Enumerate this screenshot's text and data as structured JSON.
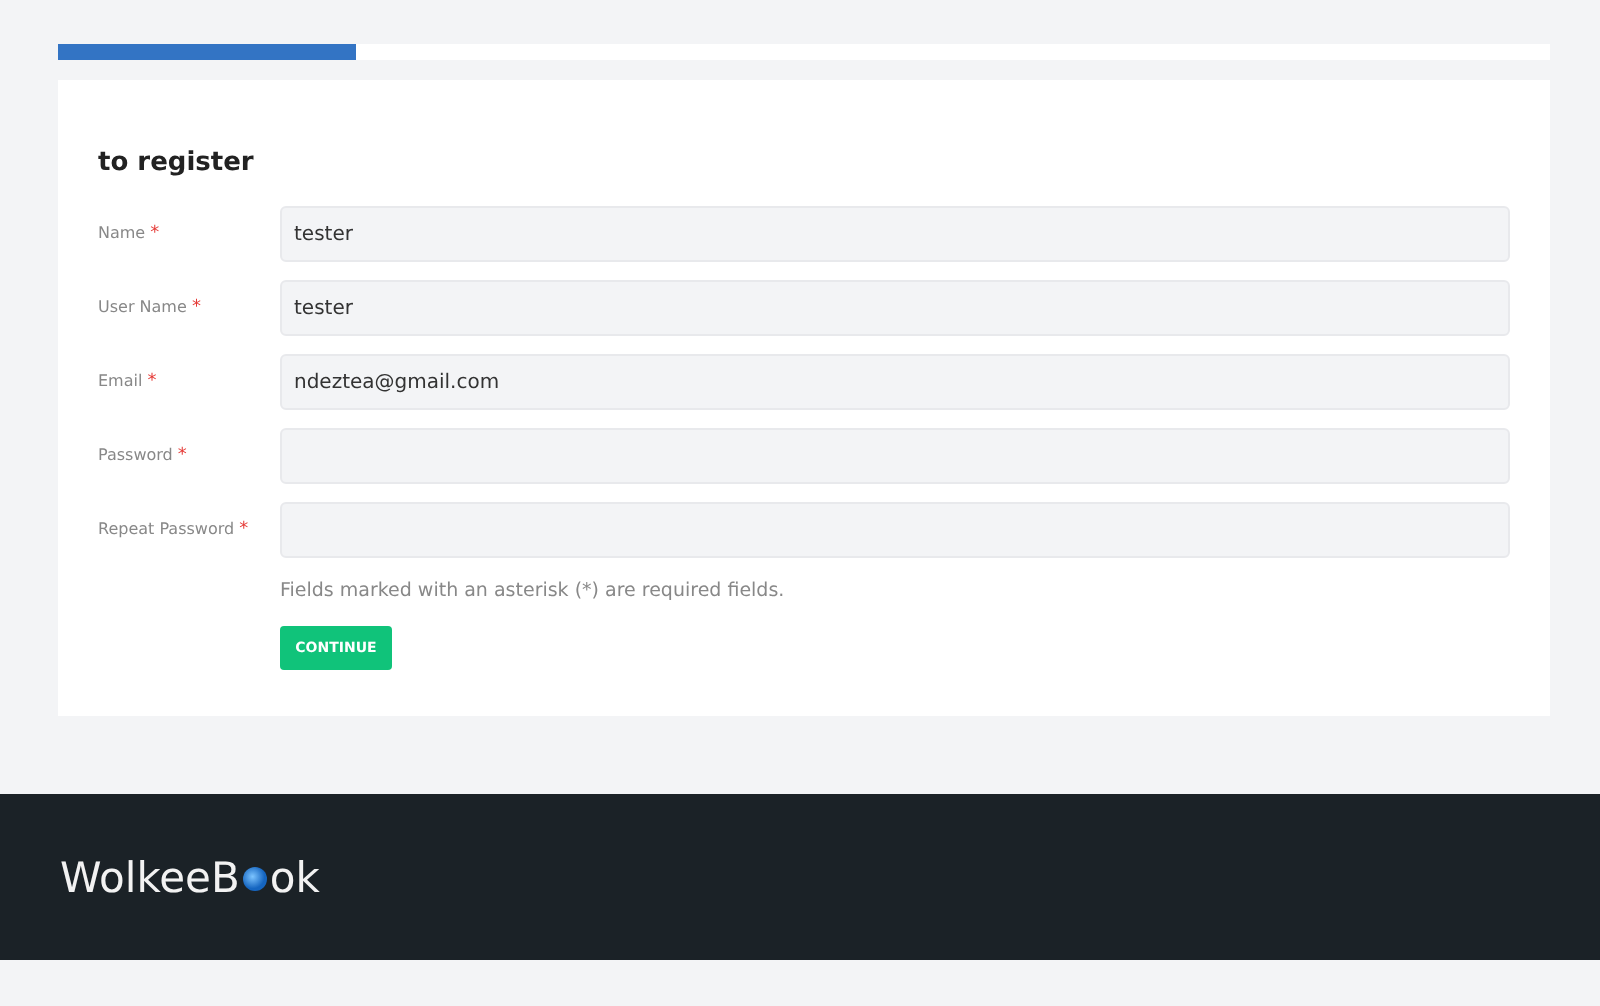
{
  "progress": {
    "level": 0.2
  },
  "form": {
    "title": "to register",
    "fields": [
      {
        "label": "Name",
        "required_mark": "*",
        "value": "tester"
      },
      {
        "label": "User Name",
        "required_mark": "*",
        "value": "tester"
      },
      {
        "label": "Email",
        "required_mark": "*",
        "value": "ndeztea@gmail.com"
      },
      {
        "label": "Password",
        "required_mark": "*"
      },
      {
        "label": "Repeat Password",
        "required_mark": "*"
      }
    ],
    "note": "Fields marked with an asterisk (*) are required fields.",
    "button": "CONTINUE"
  },
  "footer": {
    "logo_start": "WolkeeB",
    "logo_end": "ok"
  }
}
